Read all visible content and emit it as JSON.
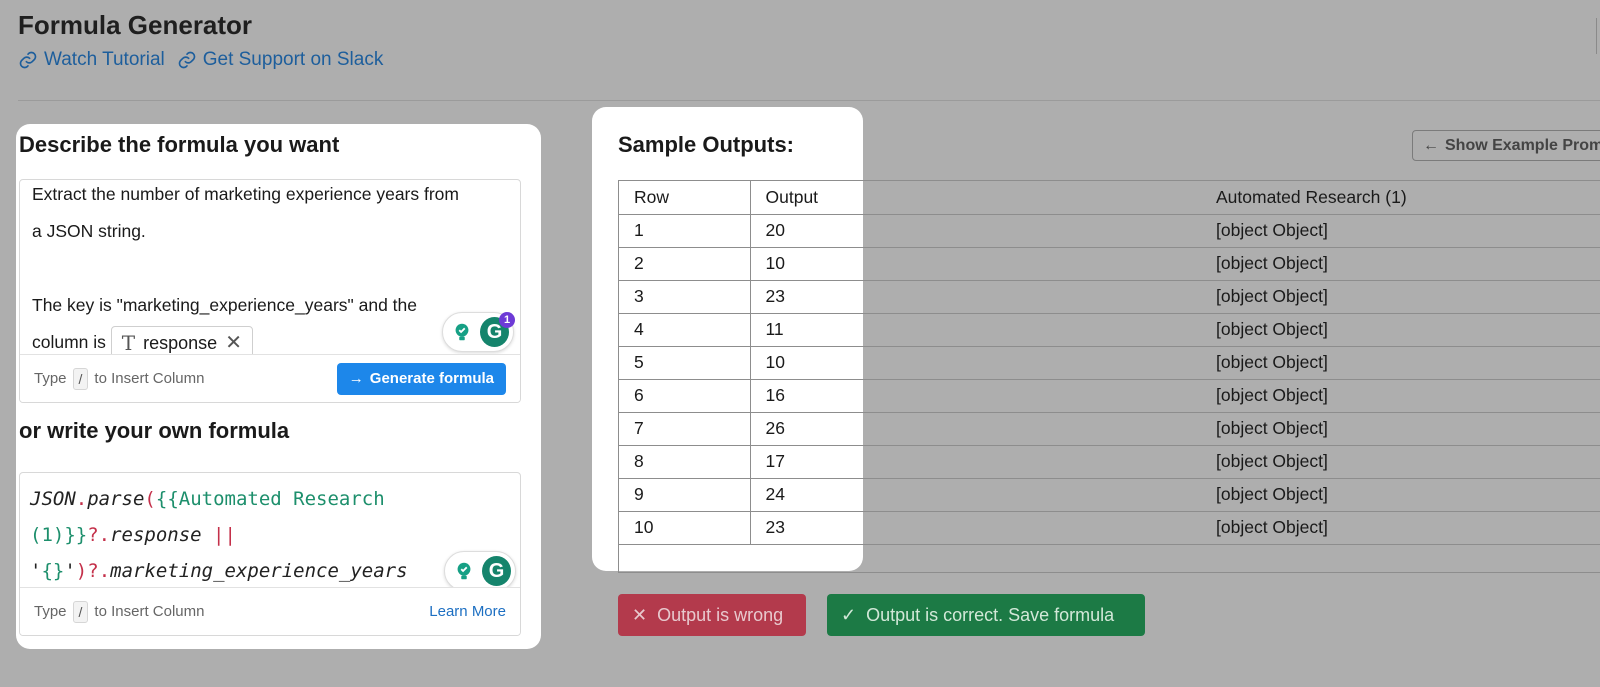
{
  "header": {
    "title": "Formula Generator",
    "links": [
      {
        "label": "Watch Tutorial",
        "icon": "link-icon"
      },
      {
        "label": "Get Support on Slack",
        "icon": "link-icon"
      }
    ]
  },
  "describe": {
    "heading": "Describe the formula you want",
    "line1": "Extract the number of marketing experience years from",
    "line2": "a JSON string.",
    "line3": "The key is \"marketing_experience_years\" and the",
    "line4_prefix": "column is",
    "column_chip": "response",
    "hint_type": "Type",
    "hint_key": "/",
    "hint_rest": "to Insert Column",
    "generate_label": "Generate formula",
    "grammarly_badge": "1"
  },
  "own_formula": {
    "heading": "or write your own formula",
    "code": {
      "fn1": "JSON",
      "dot1": ".",
      "fn2": "parse",
      "paren_open": "(",
      "var1": "{{Automated Research",
      "var2": "(1)}}",
      "opt": "?.",
      "prop1": "response",
      "or": " ||",
      "str_q1": "'",
      "str_body": "{}",
      "str_q2": "'",
      "paren_close": ")",
      "opt2": "?.",
      "prop2": "marketing_experience_years"
    },
    "hint_type": "Type",
    "hint_key": "/",
    "hint_rest": "to Insert Column",
    "learn_more": "Learn More"
  },
  "samples": {
    "heading": "Sample Outputs:",
    "show_example_label": "Show Example Promp",
    "columns": [
      "Row",
      "Output",
      "Automated Research (1)"
    ],
    "rows": [
      [
        "1",
        "20",
        "[object Object]"
      ],
      [
        "2",
        "10",
        "[object Object]"
      ],
      [
        "3",
        "23",
        "[object Object]"
      ],
      [
        "4",
        "11",
        "[object Object]"
      ],
      [
        "5",
        "10",
        "[object Object]"
      ],
      [
        "6",
        "16",
        "[object Object]"
      ],
      [
        "7",
        "26",
        "[object Object]"
      ],
      [
        "8",
        "17",
        "[object Object]"
      ],
      [
        "9",
        "24",
        "[object Object]"
      ],
      [
        "10",
        "23",
        "[object Object]"
      ]
    ]
  },
  "actions": {
    "wrong_label": "Output is wrong",
    "correct_label": "Output is correct. Save formula"
  },
  "colors": {
    "accent_blue": "#1d87ea",
    "link_blue": "#1d5e9c",
    "wrong_red": "#b33a4c",
    "correct_green": "#1c7a45",
    "overlay_gray": "#aeaeae"
  }
}
